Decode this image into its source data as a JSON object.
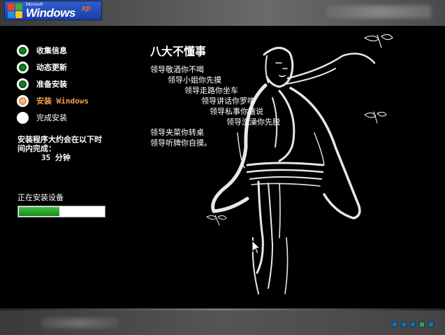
{
  "logo": {
    "brand_small": "Microsoft",
    "brand": "Windows",
    "edition": "xp"
  },
  "steps": [
    {
      "label": "收集信息",
      "state": "done"
    },
    {
      "label": "动态更新",
      "state": "done"
    },
    {
      "label": "准备安装",
      "state": "done"
    },
    {
      "label": "安装 Windows",
      "state": "current"
    },
    {
      "label": "完成安装",
      "state": "pending"
    }
  ],
  "estimate": {
    "text": "安装程序大约会在以下时间内完成：",
    "minutes": "35 分钟"
  },
  "status": {
    "text": "正在安装设备",
    "progress_percent": 48
  },
  "poem": {
    "title": "八大不懂事",
    "lines": [
      "领导敬酒你不喝",
      "领导小姐你先摸",
      "领导走路你坐车",
      "领导讲话你罗嗦",
      "领导私事你瞎说",
      "领导洗澡你先脱",
      "领导夹菜你转桌",
      "领导听牌你自摸。"
    ]
  },
  "colors": {
    "accent_current": "#f0a050",
    "progress_fill": "#1a8a20",
    "background": "#000000"
  }
}
